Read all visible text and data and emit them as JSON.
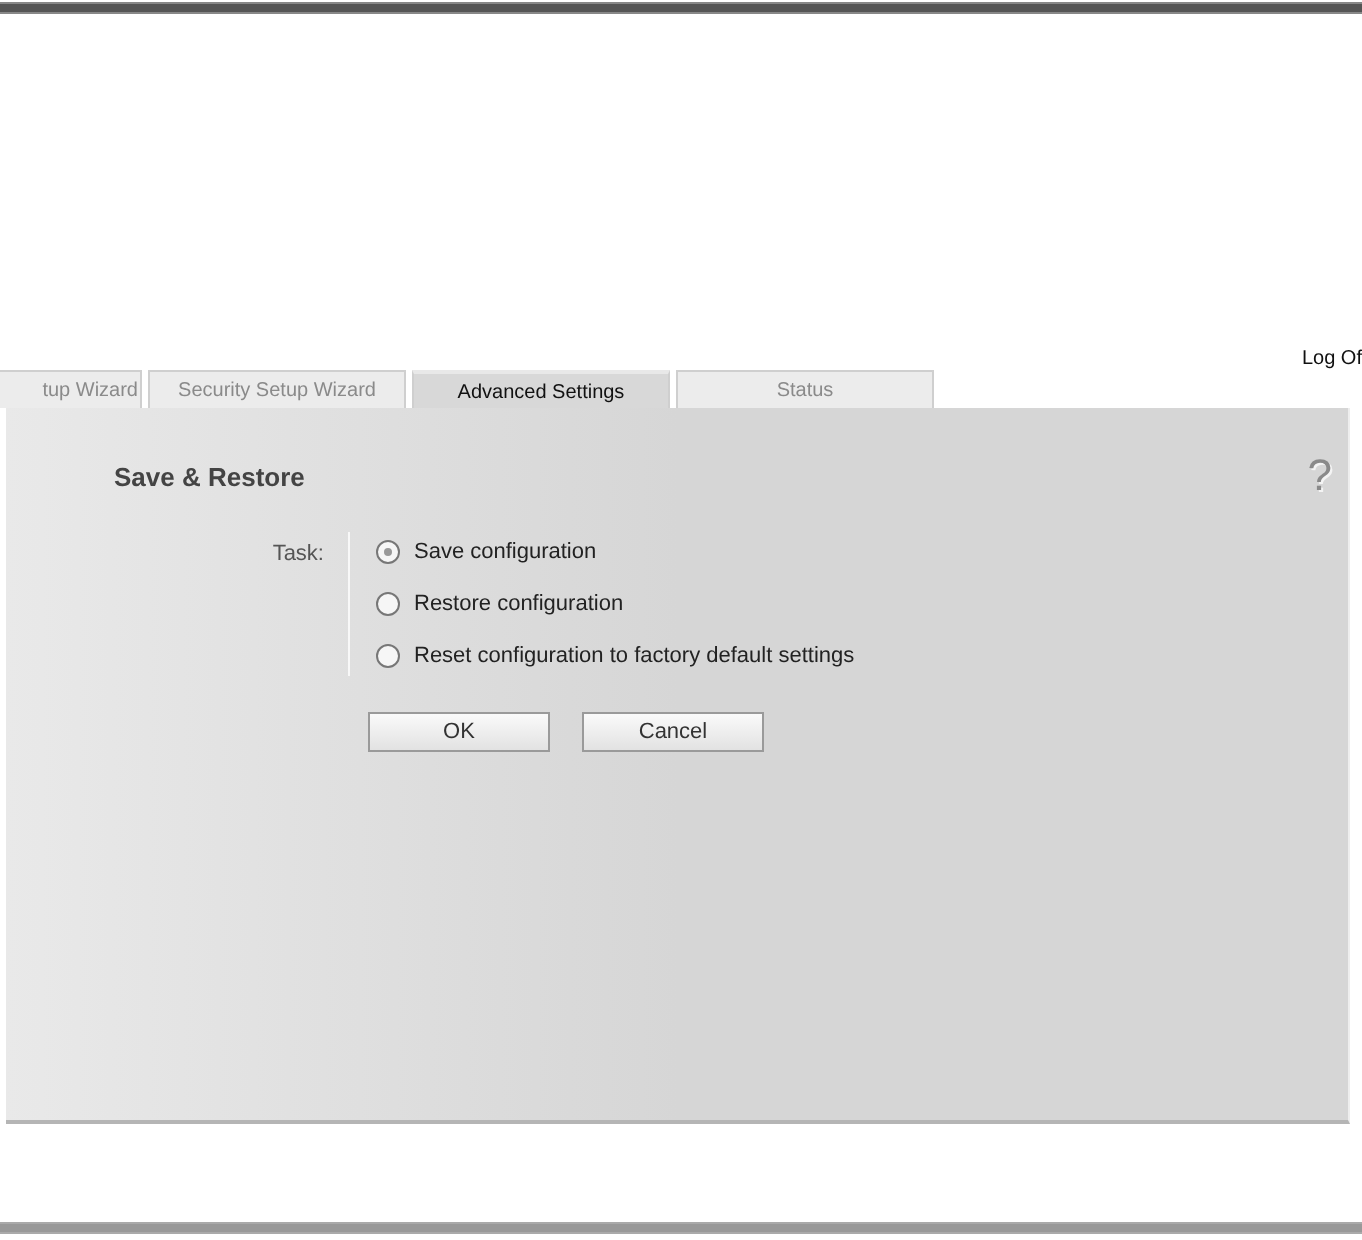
{
  "tabs": [
    {
      "label": "tup Wizard",
      "selected": false
    },
    {
      "label": "Security Setup Wizard",
      "selected": false
    },
    {
      "label": "Advanced Settings",
      "selected": true
    },
    {
      "label": "Status",
      "selected": false
    }
  ],
  "log_off": "Log Of",
  "help": "?",
  "panel": {
    "title": "Save & Restore",
    "task_label": "Task:",
    "options": [
      {
        "label": "Save configuration",
        "selected": true
      },
      {
        "label": "Restore configuration",
        "selected": false
      },
      {
        "label": "Reset configuration to factory default settings",
        "selected": false
      }
    ],
    "buttons": [
      "OK",
      "Cancel"
    ]
  }
}
